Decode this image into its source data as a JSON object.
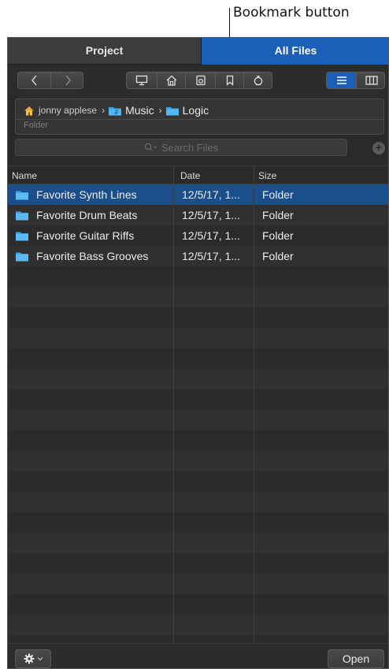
{
  "callout": {
    "text": "Bookmark button"
  },
  "tabs": [
    {
      "label": "Project",
      "active": false
    },
    {
      "label": "All Files",
      "active": true
    }
  ],
  "toolbar": {
    "back_icon": "chevron-left-icon",
    "forward_icon": "chevron-right-icon",
    "location_icons": [
      "computer-icon",
      "home-icon",
      "project-icon",
      "bookmark-icon",
      "recent-icon"
    ],
    "view_modes": [
      "list-view-icon",
      "column-view-icon"
    ],
    "active_view": "list"
  },
  "path": {
    "user_label": "jonny applese",
    "crumbs": [
      "Music",
      "Logic"
    ],
    "kind": "Folder"
  },
  "search": {
    "placeholder": "Search Files"
  },
  "columns": {
    "name": "Name",
    "date": "Date",
    "size": "Size"
  },
  "rows": [
    {
      "name": "Favorite Synth Lines",
      "date": "12/5/17, 1...",
      "size": "Folder",
      "selected": true
    },
    {
      "name": "Favorite Drum Beats",
      "date": "12/5/17, 1...",
      "size": "Folder",
      "selected": false
    },
    {
      "name": "Favorite Guitar Riffs",
      "date": "12/5/17, 1...",
      "size": "Folder",
      "selected": false
    },
    {
      "name": "Favorite Bass Grooves",
      "date": "12/5/17, 1...",
      "size": "Folder",
      "selected": false
    }
  ],
  "bottom": {
    "open_label": "Open",
    "action_icon": "gear-icon"
  },
  "colors": {
    "accent": "#1b5fb8",
    "selection": "#1b4f8c",
    "folder": "#3aa2e6",
    "panel": "#2a2a2a"
  }
}
